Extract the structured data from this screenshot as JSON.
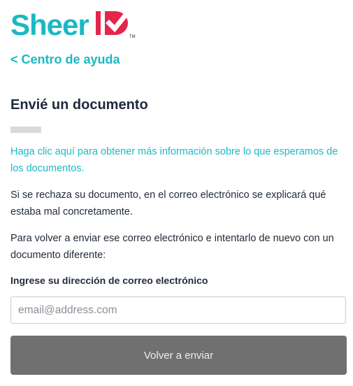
{
  "logo": {
    "name": "SheerID",
    "text": "Sheer",
    "trademark": "TM",
    "colors": {
      "teal": "#1bb8c3",
      "red": "#e5254b"
    }
  },
  "nav": {
    "back_label": "< Centro de ayuda"
  },
  "page": {
    "title": "Envié un documento",
    "info_link": "Haga clic aquí para obtener más información sobre lo que esperamos de los documentos.",
    "paragraph1": "Si se rechaza su documento, en el correo electrónico se explicará qué estaba mal concretamente.",
    "paragraph2": "Para volver a enviar ese correo electrónico e intentarlo de nuevo con un documento diferente:"
  },
  "form": {
    "email_label": "Ingrese su dirección de correo electrónico",
    "email_placeholder": "email@address.com",
    "email_value": "",
    "submit_label": "Volver a enviar"
  },
  "colors": {
    "accent": "#1bb8c3",
    "button_bg": "#707070",
    "button_text": "#eeeeee",
    "heading": "#1f2a3a"
  }
}
